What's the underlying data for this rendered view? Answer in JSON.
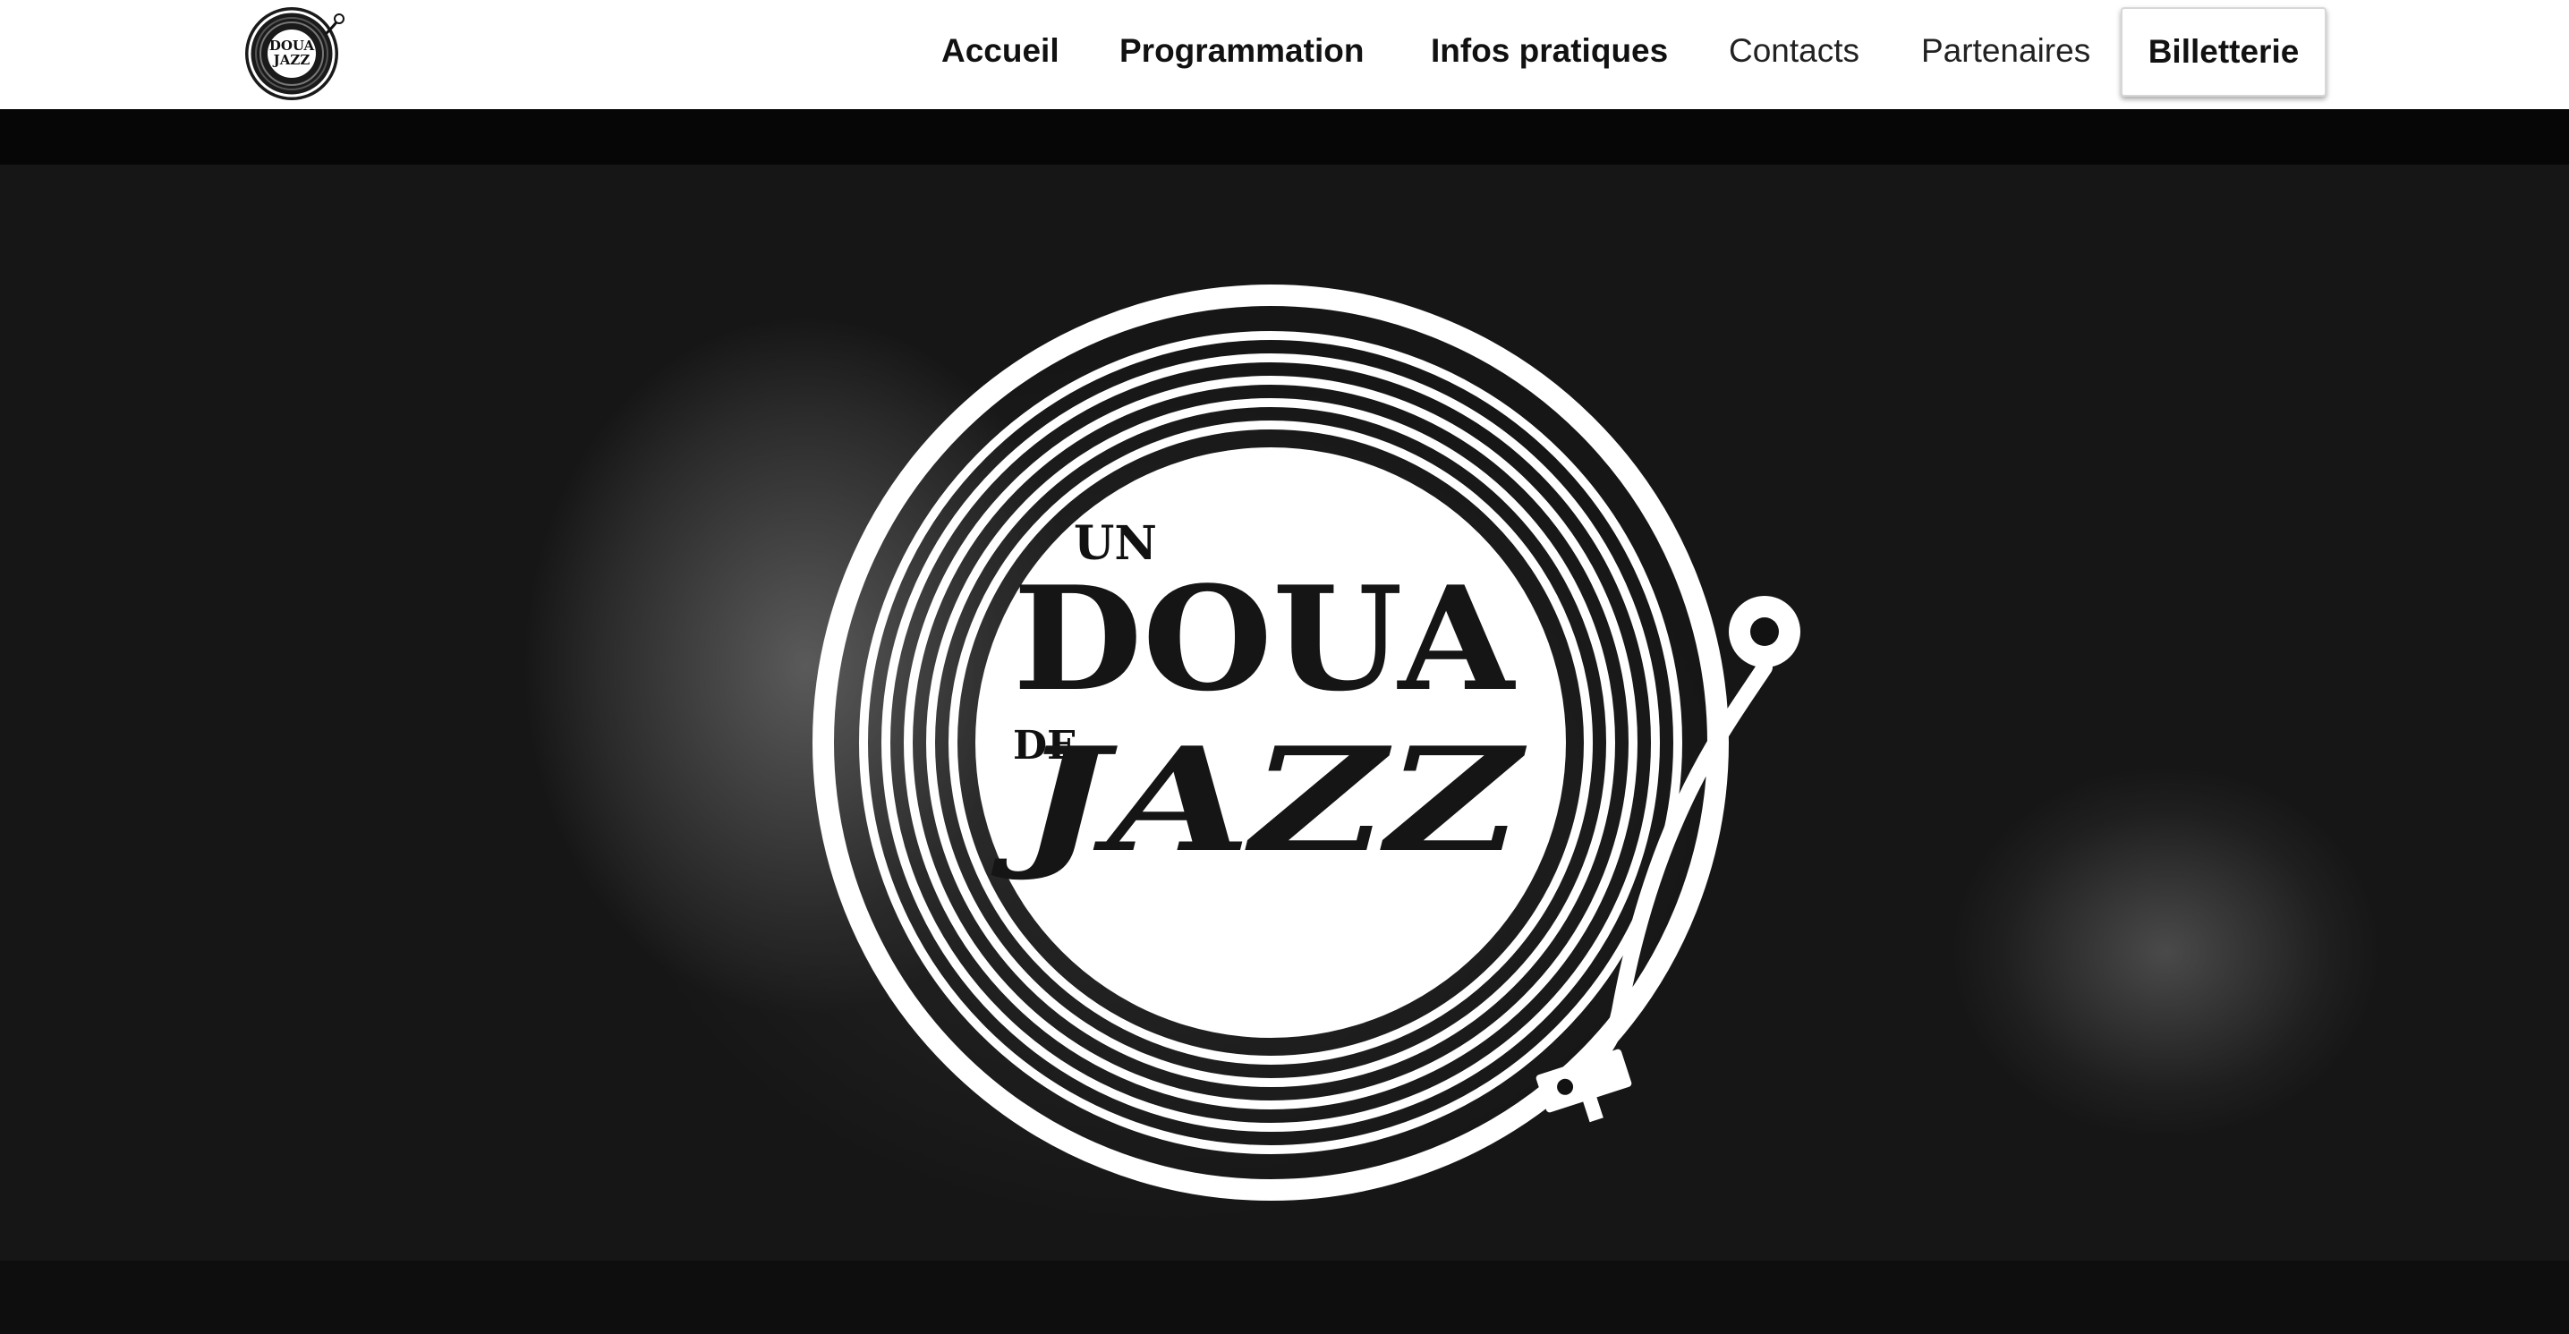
{
  "brand": {
    "logo_line1": "DOUA",
    "logo_line2": "JAZZ"
  },
  "nav": {
    "items": [
      {
        "label": "Accueil"
      },
      {
        "label": "Programmation"
      },
      {
        "label": "Infos pratiques"
      },
      {
        "label": "Contacts"
      },
      {
        "label": "Partenaires"
      }
    ],
    "cta_label": "Billetterie"
  },
  "hero": {
    "logo": {
      "word_un": "UN",
      "word_doua": "DOUA",
      "word_de": "DE",
      "word_jazz": "JAZZ"
    }
  },
  "colors": {
    "header_bg": "#ffffff",
    "hero_bg": "#121212",
    "logo_white": "#ffffff",
    "text_dark": "#111111"
  }
}
